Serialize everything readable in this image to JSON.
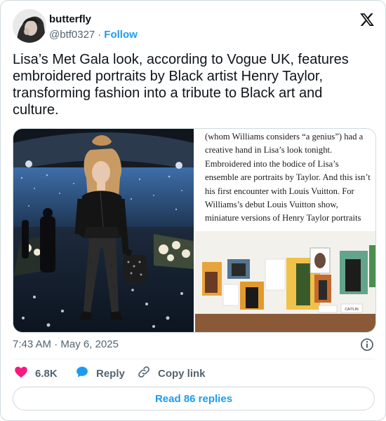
{
  "author": {
    "name": "butterfly",
    "handle": "@btf0327",
    "separator": "·",
    "follow_label": "Follow"
  },
  "tweet": {
    "text": "Lisa’s Met Gala look, according to Vogue UK, features embroidered portraits by Black artist Henry Taylor, transforming fashion into a tribute to Black art and culture."
  },
  "media": {
    "article_excerpt": "(whom Williams considers “a genius”) had a creative hand in Lisa’s look tonight. Embroidered into the bodice of Lisa’s ensemble are portraits by Taylor. And this isn’t his first encounter with Louis Vuitton. For Williams’s debut Louis Vuitton show, miniature versions of Henry Taylor portraits",
    "gallery_label": "CAITLIN"
  },
  "meta": {
    "timestamp": "7:43 AM · May 6, 2025"
  },
  "actions": {
    "likes_count": "6.8K",
    "reply_label": "Reply",
    "copy_link_label": "Copy link"
  },
  "footer": {
    "read_replies_label": "Read 86 replies"
  },
  "colors": {
    "accent": "#1d9bf0",
    "like": "#f91880",
    "text": "#0f1419",
    "muted": "#536471",
    "border": "#cfd9de"
  },
  "icons": [
    "x-logo-icon",
    "heart-icon",
    "reply-bubble-icon",
    "link-icon",
    "info-icon"
  ]
}
